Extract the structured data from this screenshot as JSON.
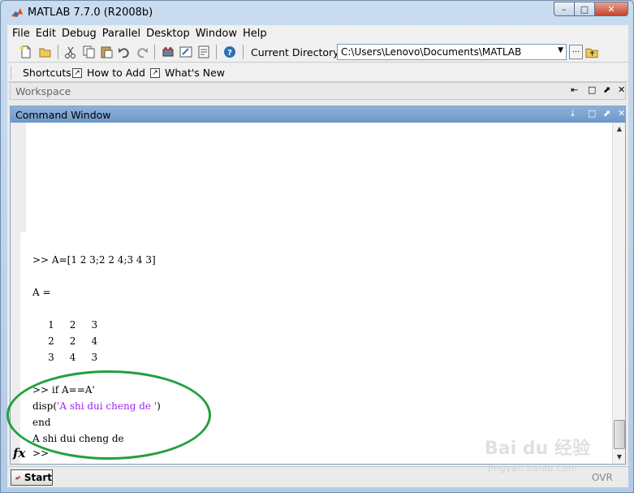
{
  "window": {
    "title": "MATLAB  7.7.0 (R2008b)",
    "min": "–",
    "max": "□",
    "close": "✕"
  },
  "menu": [
    "File",
    "Edit",
    "Debug",
    "Parallel",
    "Desktop",
    "Window",
    "Help"
  ],
  "toolbar": {
    "current_dir_label": "Current Directory:",
    "current_dir_value": "C:\\Users\\Lenovo\\Documents\\MATLAB",
    "browse_label": "..."
  },
  "shortcuts": {
    "label": "Shortcuts",
    "how_to_add": "How to Add",
    "whats_new": "What's New"
  },
  "workspace": {
    "title": "Workspace"
  },
  "command_window": {
    "title": "Command Window",
    "lines": [
      {
        "text": ">> A=[1 2 3;2 2 4;3 4 3]"
      },
      {
        "text": "A ="
      },
      {
        "text": "     1     2     3"
      },
      {
        "text": "     2     2     4"
      },
      {
        "text": "     3     4     3"
      },
      {
        "text": ">> if A==A'"
      },
      {
        "pre": "disp(",
        "str": "'A shi dui cheng de '",
        "post": ")"
      },
      {
        "text": "end"
      },
      {
        "text": "A shi dui cheng de"
      }
    ],
    "fx": "fx",
    "prompt": ">>"
  },
  "statusbar": {
    "start": "Start",
    "ovr": "OVR"
  },
  "watermark": {
    "logo": "Bai du 经验",
    "url": "jingyan.baidu.com"
  },
  "colors": {
    "string": "#a020f0",
    "highlight": "#23a03c",
    "header": "#7ea5d2"
  }
}
